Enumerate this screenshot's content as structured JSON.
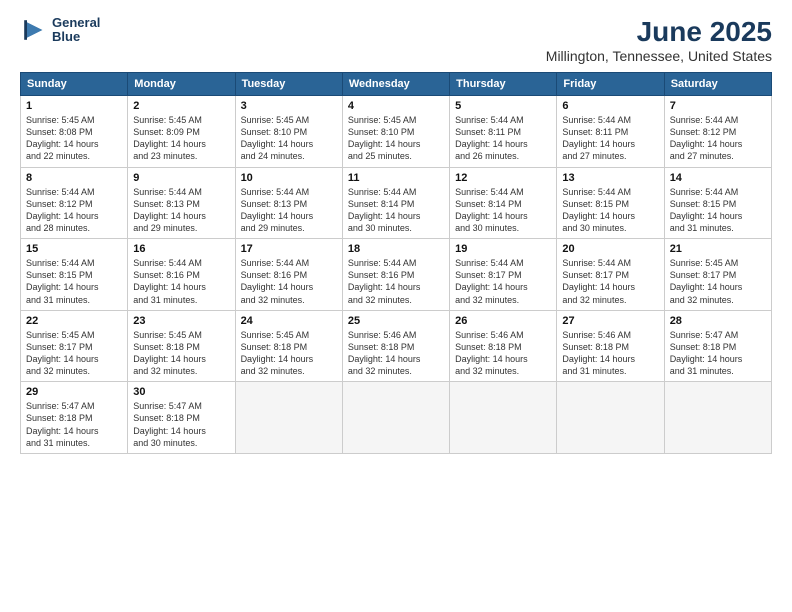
{
  "logo": {
    "line1": "General",
    "line2": "Blue"
  },
  "title": "June 2025",
  "subtitle": "Millington, Tennessee, United States",
  "headers": [
    "Sunday",
    "Monday",
    "Tuesday",
    "Wednesday",
    "Thursday",
    "Friday",
    "Saturday"
  ],
  "weeks": [
    [
      {
        "day": "1",
        "info": "Sunrise: 5:45 AM\nSunset: 8:08 PM\nDaylight: 14 hours\nand 22 minutes."
      },
      {
        "day": "2",
        "info": "Sunrise: 5:45 AM\nSunset: 8:09 PM\nDaylight: 14 hours\nand 23 minutes."
      },
      {
        "day": "3",
        "info": "Sunrise: 5:45 AM\nSunset: 8:10 PM\nDaylight: 14 hours\nand 24 minutes."
      },
      {
        "day": "4",
        "info": "Sunrise: 5:45 AM\nSunset: 8:10 PM\nDaylight: 14 hours\nand 25 minutes."
      },
      {
        "day": "5",
        "info": "Sunrise: 5:44 AM\nSunset: 8:11 PM\nDaylight: 14 hours\nand 26 minutes."
      },
      {
        "day": "6",
        "info": "Sunrise: 5:44 AM\nSunset: 8:11 PM\nDaylight: 14 hours\nand 27 minutes."
      },
      {
        "day": "7",
        "info": "Sunrise: 5:44 AM\nSunset: 8:12 PM\nDaylight: 14 hours\nand 27 minutes."
      }
    ],
    [
      {
        "day": "8",
        "info": "Sunrise: 5:44 AM\nSunset: 8:12 PM\nDaylight: 14 hours\nand 28 minutes."
      },
      {
        "day": "9",
        "info": "Sunrise: 5:44 AM\nSunset: 8:13 PM\nDaylight: 14 hours\nand 29 minutes."
      },
      {
        "day": "10",
        "info": "Sunrise: 5:44 AM\nSunset: 8:13 PM\nDaylight: 14 hours\nand 29 minutes."
      },
      {
        "day": "11",
        "info": "Sunrise: 5:44 AM\nSunset: 8:14 PM\nDaylight: 14 hours\nand 30 minutes."
      },
      {
        "day": "12",
        "info": "Sunrise: 5:44 AM\nSunset: 8:14 PM\nDaylight: 14 hours\nand 30 minutes."
      },
      {
        "day": "13",
        "info": "Sunrise: 5:44 AM\nSunset: 8:15 PM\nDaylight: 14 hours\nand 30 minutes."
      },
      {
        "day": "14",
        "info": "Sunrise: 5:44 AM\nSunset: 8:15 PM\nDaylight: 14 hours\nand 31 minutes."
      }
    ],
    [
      {
        "day": "15",
        "info": "Sunrise: 5:44 AM\nSunset: 8:15 PM\nDaylight: 14 hours\nand 31 minutes."
      },
      {
        "day": "16",
        "info": "Sunrise: 5:44 AM\nSunset: 8:16 PM\nDaylight: 14 hours\nand 31 minutes."
      },
      {
        "day": "17",
        "info": "Sunrise: 5:44 AM\nSunset: 8:16 PM\nDaylight: 14 hours\nand 32 minutes."
      },
      {
        "day": "18",
        "info": "Sunrise: 5:44 AM\nSunset: 8:16 PM\nDaylight: 14 hours\nand 32 minutes."
      },
      {
        "day": "19",
        "info": "Sunrise: 5:44 AM\nSunset: 8:17 PM\nDaylight: 14 hours\nand 32 minutes."
      },
      {
        "day": "20",
        "info": "Sunrise: 5:44 AM\nSunset: 8:17 PM\nDaylight: 14 hours\nand 32 minutes."
      },
      {
        "day": "21",
        "info": "Sunrise: 5:45 AM\nSunset: 8:17 PM\nDaylight: 14 hours\nand 32 minutes."
      }
    ],
    [
      {
        "day": "22",
        "info": "Sunrise: 5:45 AM\nSunset: 8:17 PM\nDaylight: 14 hours\nand 32 minutes."
      },
      {
        "day": "23",
        "info": "Sunrise: 5:45 AM\nSunset: 8:18 PM\nDaylight: 14 hours\nand 32 minutes."
      },
      {
        "day": "24",
        "info": "Sunrise: 5:45 AM\nSunset: 8:18 PM\nDaylight: 14 hours\nand 32 minutes."
      },
      {
        "day": "25",
        "info": "Sunrise: 5:46 AM\nSunset: 8:18 PM\nDaylight: 14 hours\nand 32 minutes."
      },
      {
        "day": "26",
        "info": "Sunrise: 5:46 AM\nSunset: 8:18 PM\nDaylight: 14 hours\nand 32 minutes."
      },
      {
        "day": "27",
        "info": "Sunrise: 5:46 AM\nSunset: 8:18 PM\nDaylight: 14 hours\nand 31 minutes."
      },
      {
        "day": "28",
        "info": "Sunrise: 5:47 AM\nSunset: 8:18 PM\nDaylight: 14 hours\nand 31 minutes."
      }
    ],
    [
      {
        "day": "29",
        "info": "Sunrise: 5:47 AM\nSunset: 8:18 PM\nDaylight: 14 hours\nand 31 minutes."
      },
      {
        "day": "30",
        "info": "Sunrise: 5:47 AM\nSunset: 8:18 PM\nDaylight: 14 hours\nand 30 minutes."
      },
      {
        "day": "",
        "info": ""
      },
      {
        "day": "",
        "info": ""
      },
      {
        "day": "",
        "info": ""
      },
      {
        "day": "",
        "info": ""
      },
      {
        "day": "",
        "info": ""
      }
    ]
  ]
}
